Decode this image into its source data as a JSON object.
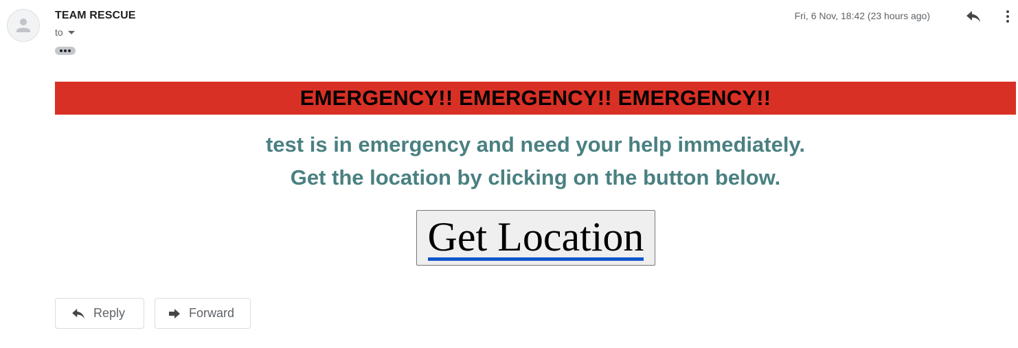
{
  "header": {
    "sender": "TEAM RESCUE",
    "to_label": "to",
    "timestamp": "Fri, 6 Nov, 18:42 (23 hours ago)"
  },
  "icons": {
    "avatar": "person-avatar-icon",
    "reply": "reply-icon",
    "more": "more-vert-icon",
    "forward": "forward-icon",
    "trim": "show-trimmed-content-icon"
  },
  "body": {
    "banner": "EMERGENCY!! EMERGENCY!! EMERGENCY!!",
    "message_line1": "test is in emergency and need your help immediately.",
    "message_line2": "Get the location by clicking on the button below.",
    "location_button": "Get Location"
  },
  "actions": {
    "reply_label": "Reply",
    "forward_label": "Forward"
  },
  "colors": {
    "banner_bg": "#d93025",
    "message_text": "#4a8081",
    "link_underline": "#1155cc"
  }
}
